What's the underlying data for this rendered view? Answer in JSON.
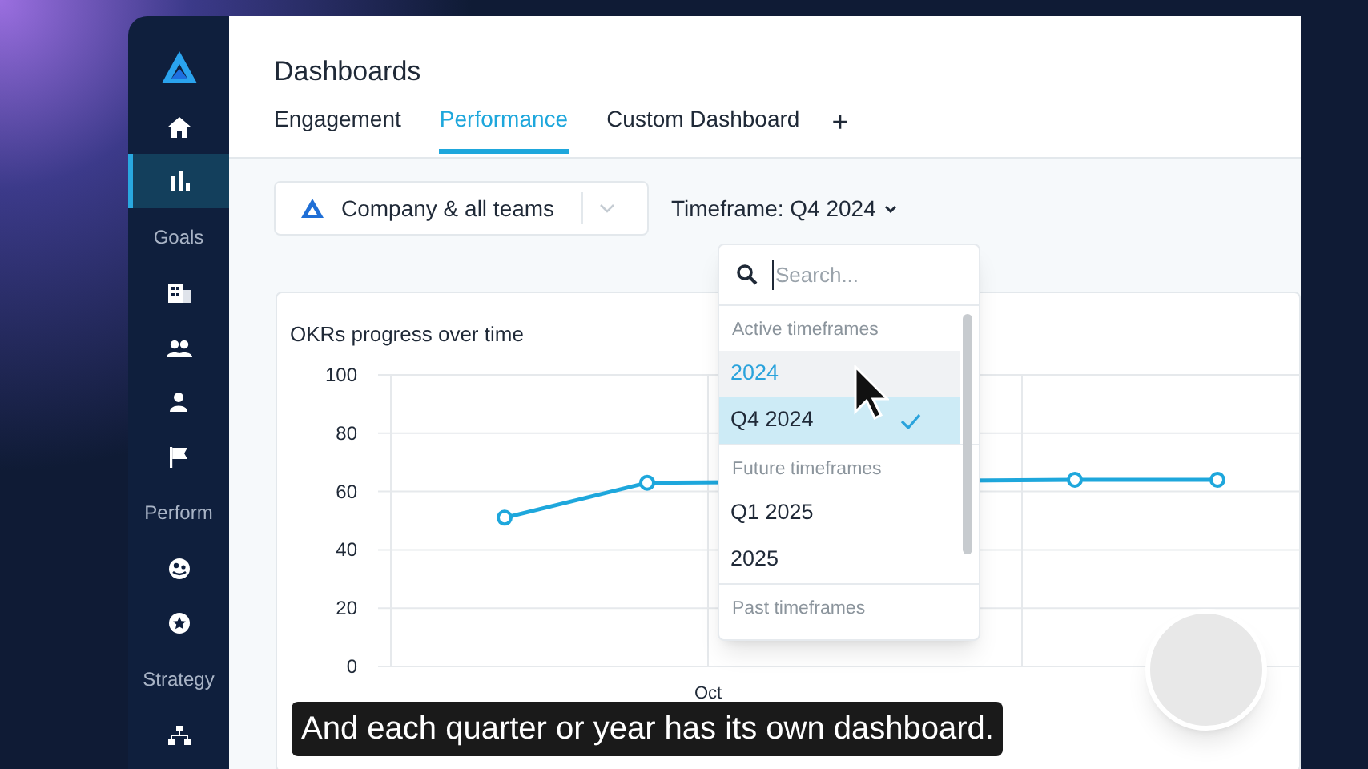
{
  "sidebar": {
    "items": [
      {
        "kind": "logo"
      },
      {
        "kind": "icon",
        "selected": false
      },
      {
        "kind": "icon",
        "selected": true
      },
      {
        "kind": "section",
        "label": "Goals"
      },
      {
        "kind": "icon",
        "selected": false
      },
      {
        "kind": "icon",
        "selected": false
      },
      {
        "kind": "icon",
        "selected": false
      },
      {
        "kind": "icon",
        "selected": false
      },
      {
        "kind": "section",
        "label": "Perform"
      },
      {
        "kind": "icon",
        "selected": false
      },
      {
        "kind": "icon",
        "selected": false
      },
      {
        "kind": "section",
        "label": "Strategy"
      },
      {
        "kind": "icon",
        "selected": false
      }
    ]
  },
  "page_title": "Dashboards",
  "tabs": [
    {
      "label": "Engagement",
      "selected": false
    },
    {
      "label": "Performance",
      "selected": true
    },
    {
      "label": "Custom Dashboard",
      "selected": false
    }
  ],
  "add_tab": "+",
  "team_select": {
    "value": "Company & all teams"
  },
  "timeframe_button": "Timeframe: Q4 2024",
  "chart_card": {
    "title": "OKRs progress over time",
    "chart_data": {
      "type": "line",
      "grid": true,
      "ylim": [
        0,
        100
      ],
      "yticks": [
        0,
        20,
        40,
        60,
        80,
        100
      ],
      "annotations": [
        {
          "text": "Oct"
        }
      ],
      "series": [
        {
          "color": "#1ea7dc",
          "marker": "circle",
          "values": [
            51,
            63,
            null,
            null,
            64,
            64
          ]
        }
      ]
    }
  },
  "timeframe_dropdown": {
    "search": {
      "placeholder": "Search..."
    },
    "groups": [
      {
        "header": "Active timeframes",
        "options": [
          {
            "label": "2024",
            "selected": false,
            "hovered": true
          },
          {
            "label": "Q4 2024",
            "selected": true,
            "hovered": false
          }
        ]
      },
      {
        "header": "Future timeframes",
        "options": [
          {
            "label": "Q1 2025",
            "selected": false,
            "hovered": false
          },
          {
            "label": "2025",
            "selected": false,
            "hovered": false
          }
        ]
      },
      {
        "header": "Past timeframes"
      }
    ]
  },
  "subtitle": "And each quarter or year has its own dashboard."
}
